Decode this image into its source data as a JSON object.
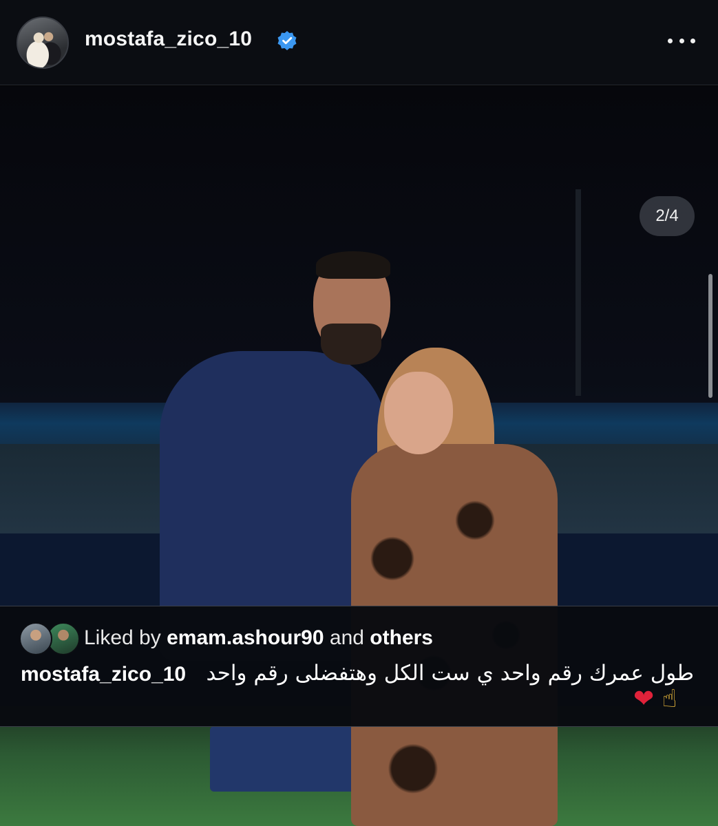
{
  "post": {
    "username": "mostafa_zico_10",
    "slide_counter": "2/4",
    "likes_prefix": "Liked by",
    "likes_user": "emam.ashour90",
    "likes_and": "and",
    "likes_others": "others",
    "caption_user": "mostafa_zico_10",
    "caption_text": "طول عمرك رقم واحد ي ست الكل وهتفضلى رقم واحد",
    "caption_emoji_heart": "❤",
    "caption_emoji_finger": "☝"
  },
  "icons": {
    "verified": "verified-badge-icon",
    "more": "more-options-icon"
  },
  "colors": {
    "background": "#0b0d12",
    "verified_blue": "#3b97f0",
    "heart": "#e0223a"
  }
}
